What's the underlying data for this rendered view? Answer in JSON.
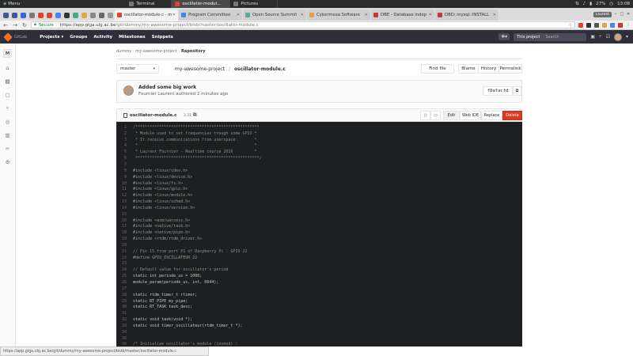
{
  "taskbar": {
    "menu_label": "Menu",
    "windows": [
      {
        "label": "Terminal",
        "active": false
      },
      {
        "label": "oscillator-modul...",
        "active": true
      },
      {
        "label": "Pictures",
        "active": false
      }
    ],
    "battery": "27%",
    "clock": "13:08"
  },
  "browser": {
    "tabs": [
      {
        "label": "oscillator-module.c · m",
        "favicon_color": "#e24329",
        "active": true
      },
      {
        "label": "Program Committee",
        "favicon_color": "#4285f4",
        "active": false
      },
      {
        "label": "Open Source Summit",
        "favicon_color": "#5a9",
        "active": false
      },
      {
        "label": "Cybermesa Software",
        "favicon_color": "#e8a33d",
        "active": false
      },
      {
        "label": "DBE - Database indep",
        "favicon_color": "#cc3333",
        "active": false
      },
      {
        "label": "DBD::mysql::INSTALL",
        "favicon_color": "#cc3333",
        "active": false
      }
    ],
    "user_badge": "Laurent",
    "secure_label": "Secure",
    "url_host": "https://app.giga.ulg.ac.be",
    "url_path": "/git/dummy/my-awesome-project/blob/master/oscillator-module.c",
    "status_url": "https://app.giga.ulg.ac.be/git/dummy/my-awesome-project/blob/master/oscillator-module.c"
  },
  "gitlab_nav": {
    "brand": "GitLab",
    "links": [
      "Projects ▾",
      "Groups",
      "Activity",
      "Milestones",
      "Snippets"
    ],
    "this_project": "This project",
    "search_placeholder": "Search"
  },
  "sidebar": {
    "project_initial": "M",
    "items": [
      "home-icon",
      "repository-icon",
      "issues-icon",
      "merge-requests-icon",
      "pipelines-icon",
      "wiki-icon",
      "snippets-icon",
      "settings-icon"
    ]
  },
  "repo": {
    "crumb_group": "dummy",
    "crumb_project": "my-awesome-project",
    "crumb_current": "Repository",
    "branch": "master",
    "path_project": "my-awesome-project",
    "path_file": "oscillator-module.c",
    "find_file": "Find file",
    "blame": "Blame",
    "history": "History",
    "permalink": "Permalink"
  },
  "commit": {
    "title": "Added some big work",
    "author_line": "Fournier Laurent authored 2 minutes ago",
    "sha": "f8afacfd"
  },
  "file": {
    "name": "oscillator-module.c",
    "size": "3.31 KB",
    "edit": "Edit",
    "web_ide": "Web IDE",
    "replace": "Replace",
    "delete": "Delete"
  },
  "code": [
    {
      "n": "1",
      "t": "/****************************************************",
      "k": "comment"
    },
    {
      "n": "2",
      "t": " * Module used to set frequencies trough some GPIO *",
      "k": "comment"
    },
    {
      "n": "3",
      "t": " * It receive communications from userspace.       *",
      "k": "comment"
    },
    {
      "n": "4",
      "t": " *                                                 *",
      "k": "comment"
    },
    {
      "n": "5",
      "t": " * Laurent Fournier - Realtime course 2016         *",
      "k": "comment"
    },
    {
      "n": "6",
      "t": " ****************************************************/",
      "k": "comment"
    },
    {
      "n": "7",
      "t": "",
      "k": "code"
    },
    {
      "n": "8",
      "t": "#include <linux/cdev.h>",
      "k": "pre"
    },
    {
      "n": "9",
      "t": "#include <linux/device.h>",
      "k": "pre"
    },
    {
      "n": "10",
      "t": "#include <linux/fs.h>",
      "k": "pre"
    },
    {
      "n": "11",
      "t": "#include <linux/gpio.h>",
      "k": "pre"
    },
    {
      "n": "12",
      "t": "#include <linux/module.h>",
      "k": "pre"
    },
    {
      "n": "13",
      "t": "#include <linux/sched.h>",
      "k": "pre"
    },
    {
      "n": "14",
      "t": "#include <linux/version.h>",
      "k": "pre"
    },
    {
      "n": "15",
      "t": "",
      "k": "code"
    },
    {
      "n": "16",
      "t": "#include <asm/uaccess.h>",
      "k": "pre"
    },
    {
      "n": "17",
      "t": "#include <native/task.h>",
      "k": "pre"
    },
    {
      "n": "18",
      "t": "#include <native/pipe.h>",
      "k": "pre"
    },
    {
      "n": "19",
      "t": "#include <rtdm/rtdm_driver.h>",
      "k": "pre"
    },
    {
      "n": "20",
      "t": "",
      "k": "code"
    },
    {
      "n": "21",
      "t": "// Pin 15 from port P1 of Raspberry Pi : GPIO 22",
      "k": "comment"
    },
    {
      "n": "22",
      "t": "#define GPIO_OSCILLATEUR 22",
      "k": "pre"
    },
    {
      "n": "23",
      "t": "",
      "k": "code"
    },
    {
      "n": "24",
      "t": "// Default value for oscillator's period",
      "k": "comment"
    },
    {
      "n": "25",
      "t": "static int periode_us = 1000;",
      "k": "code"
    },
    {
      "n": "26",
      "t": "module_param(periode_us, int, 0644);",
      "k": "code"
    },
    {
      "n": "27",
      "t": "",
      "k": "code"
    },
    {
      "n": "28",
      "t": "static rtdm_timer_t rtimer;",
      "k": "code"
    },
    {
      "n": "29",
      "t": "static RT_PIPE my_pipe;",
      "k": "code"
    },
    {
      "n": "30",
      "t": "static RT_TASK task_desc;",
      "k": "code"
    },
    {
      "n": "31",
      "t": "",
      "k": "code"
    },
    {
      "n": "32",
      "t": "static void task(void *);",
      "k": "code"
    },
    {
      "n": "33",
      "t": "static void timer_oscillateur(rtdm_timer_t *);",
      "k": "code"
    },
    {
      "n": "34",
      "t": "",
      "k": "code"
    },
    {
      "n": "35",
      "t": "",
      "k": "code"
    },
    {
      "n": "36",
      "t": "/* Initialize oscillator's module (insmod) :",
      "k": "comment"
    }
  ]
}
